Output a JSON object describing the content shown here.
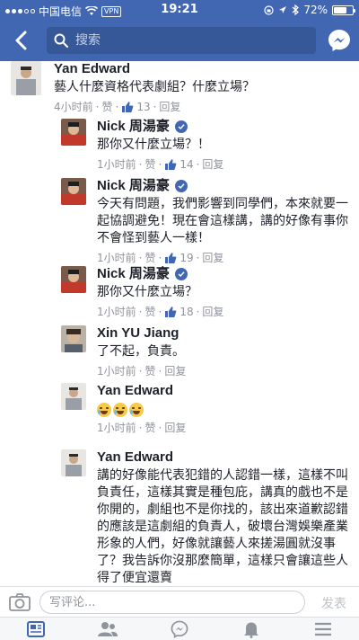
{
  "status_bar": {
    "carrier": "中国电信",
    "vpn": "VPN",
    "time": "19:21",
    "battery": "72%",
    "battery_level": 0.72
  },
  "search": {
    "placeholder": "搜索"
  },
  "colors": {
    "brand": "#4267b2",
    "meta_gray": "#90949c",
    "like_blue": "#4267b2"
  },
  "comments": [
    {
      "name": "Yan Edward",
      "text": "藝人什麼資格代表劇組？什麼立場？",
      "time": "4小时前",
      "like": "赞",
      "likes": "13",
      "reply": "回复"
    },
    {
      "name": "Nick 周湯豪",
      "verified": true,
      "text": "那你又什麼立場？！",
      "time": "1小时前",
      "like": "赞",
      "likes": "14",
      "reply": "回复"
    },
    {
      "name": "Nick 周湯豪",
      "verified": true,
      "text": "今天有問題，我們影響到同學們，本來就要一起協調避免！現在會這樣講，講的好像有事你不會怪到藝人一樣！",
      "time": "1小时前",
      "like": "赞",
      "likes": "19",
      "reply": "回复"
    },
    {
      "name": "Nick 周湯豪",
      "verified": true,
      "text": "那你又什麼立場？",
      "time": "1小时前",
      "like": "赞",
      "likes": "18",
      "reply": "回复"
    },
    {
      "name": "Xin YU Jiang",
      "text": "了不起，負責。",
      "time": "1小时前",
      "like": "赞",
      "reply": "回复"
    },
    {
      "name": "Yan Edward",
      "emoji": [
        "rofl-emoji",
        "rofl-emoji",
        "rofl-emoji"
      ],
      "time": "1小时前",
      "like": "赞",
      "reply": "回复"
    },
    {
      "name": "Yan Edward",
      "text": "講的好像能代表犯錯的人認錯一樣，這樣不叫負責任，這樣其實是種包庇，講真的戲也不是你開的，劇組也不是你找的，該出來道歉認錯的應該是這劇組的負責人，破壞台灣娛樂產業形象的人們，好像就讓藝人來搓湯圓就沒事了？我告訴你沒那麼簡單，這樣只會讓這些人得了便宜還賣"
    }
  ],
  "composer": {
    "placeholder": "写评论...",
    "send": "发表"
  },
  "tabs": [
    "news-feed-icon",
    "friends-icon",
    "messenger-icon",
    "notifications-icon",
    "menu-icon"
  ]
}
